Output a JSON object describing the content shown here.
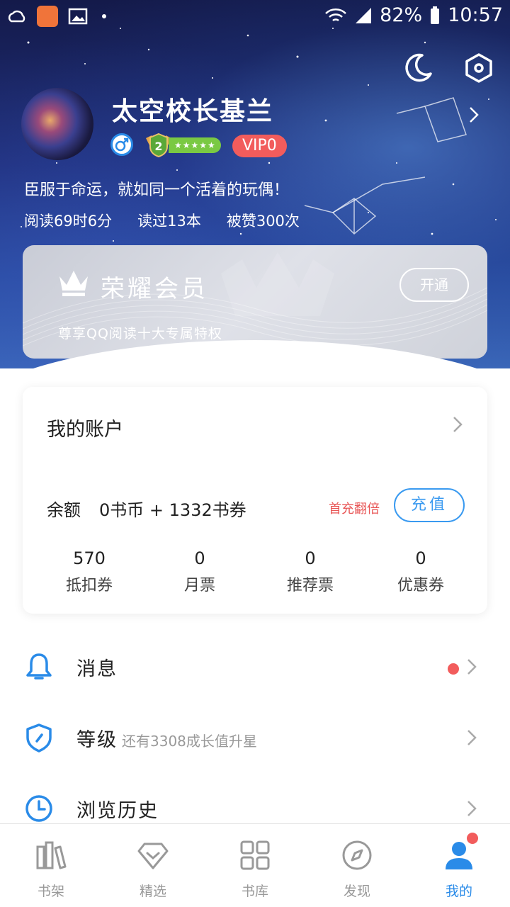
{
  "status_bar": {
    "battery": "82%",
    "time": "10:57"
  },
  "profile": {
    "nickname": "太空校长基兰",
    "level": "2",
    "level_stars": "★★★★★",
    "vip": "VIP0",
    "signature": "臣服于命运，就如同一个活着的玩偶！",
    "stats": [
      "阅读69时6分",
      "读过13本",
      "被赞300次"
    ]
  },
  "vip_card": {
    "title": "荣耀会员",
    "subtitle": "尊享QQ阅读十大专属特权",
    "button": "开通"
  },
  "account": {
    "title": "我的账户",
    "balance_label": "余额",
    "balance_value": "0书币 + 1332书券",
    "first_charge": "首充翻倍",
    "recharge": "充值",
    "tickets": [
      {
        "value": "570",
        "label": "抵扣券"
      },
      {
        "value": "0",
        "label": "月票"
      },
      {
        "value": "0",
        "label": "推荐票"
      },
      {
        "value": "0",
        "label": "优惠券"
      }
    ]
  },
  "menu": [
    {
      "label": "消息",
      "sub": "",
      "icon": "bell-icon"
    },
    {
      "label": "等级",
      "sub": "还有3308成长值升星",
      "icon": "shield-icon"
    },
    {
      "label": "浏览历史",
      "sub": "",
      "icon": "clock-icon"
    }
  ],
  "tabs": [
    {
      "label": "书架",
      "icon": "bookshelf-icon"
    },
    {
      "label": "精选",
      "icon": "diamond-icon"
    },
    {
      "label": "书库",
      "icon": "grid-icon"
    },
    {
      "label": "发现",
      "icon": "compass-icon"
    },
    {
      "label": "我的",
      "icon": "user-icon"
    }
  ],
  "colors": {
    "accent": "#2a8be8",
    "alert": "#f25c5c",
    "level_green": "#7ac943"
  }
}
